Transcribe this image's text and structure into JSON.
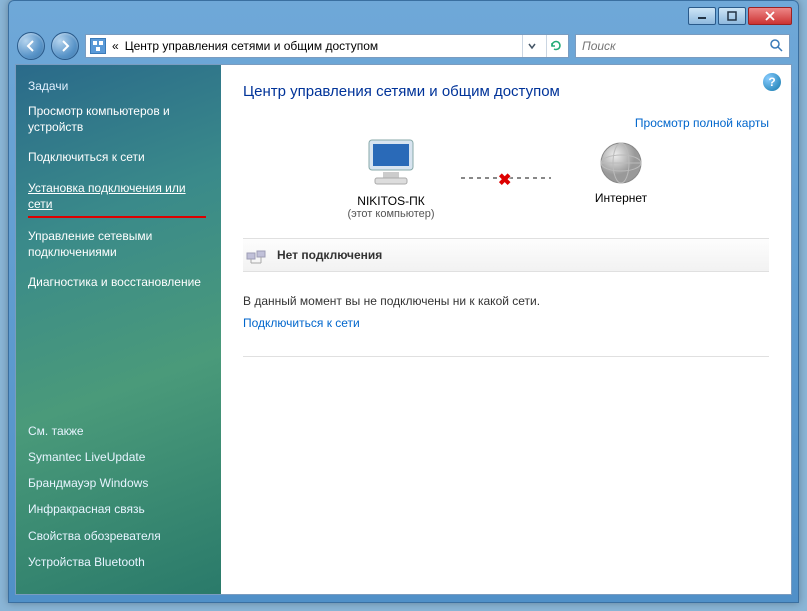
{
  "titlebar": {
    "min_tip": "Свернуть",
    "max_tip": "Развернуть",
    "close_tip": "Закрыть"
  },
  "nav": {
    "back_tip": "Назад",
    "fwd_tip": "Вперед",
    "breadcrumb_prefix": "«",
    "breadcrumb": "Центр управления сетями и общим доступом",
    "search_placeholder": "Поиск"
  },
  "sidebar": {
    "heading": "Задачи",
    "items": [
      "Просмотр компьютеров и устройств",
      "Подключиться к сети",
      "Установка подключения или сети",
      "Управление сетевыми подключениями",
      "Диагностика и восстановление"
    ],
    "see_also": "См. также",
    "bottom": [
      "Symantec LiveUpdate",
      "Брандмауэр Windows",
      "Инфракрасная связь",
      "Свойства обозревателя",
      "Устройства Bluetooth"
    ]
  },
  "main": {
    "title": "Центр управления сетями и общим доступом",
    "map_link": "Просмотр полной карты",
    "this_pc": "NIKITOS-ПК",
    "this_pc_sub": "(этот компьютер)",
    "internet": "Интернет",
    "status": "Нет подключения",
    "msg": "В данный момент вы не подключены ни к какой сети.",
    "connect_link": "Подключиться к сети"
  }
}
